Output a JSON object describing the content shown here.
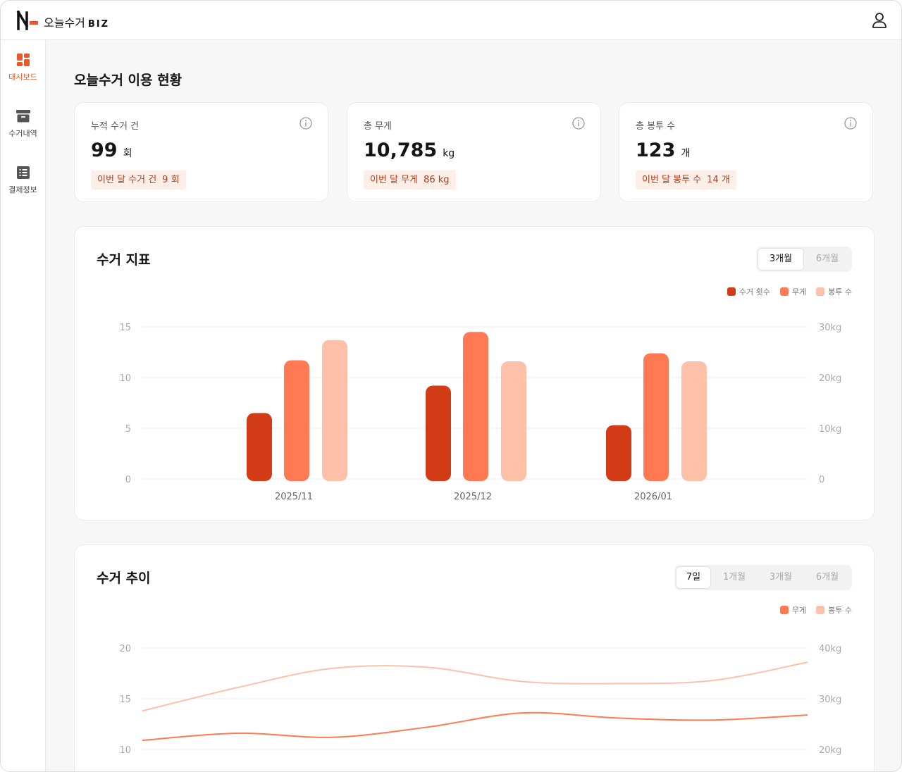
{
  "app": {
    "brand_name": "오늘수거",
    "brand_suffix": "BIZ"
  },
  "sidebar": {
    "items": [
      {
        "label": "대시보드",
        "icon": "dashboard-icon",
        "active": true
      },
      {
        "label": "수거내역",
        "icon": "archive-icon",
        "active": false
      },
      {
        "label": "결제정보",
        "icon": "list-icon",
        "active": false
      }
    ]
  },
  "page": {
    "title": "오늘수거 이용 현황"
  },
  "stats": [
    {
      "label": "누적 수거 건",
      "value": "99",
      "unit": "회",
      "badge_label": "이번 달 수거 건",
      "badge_value": "9 회"
    },
    {
      "label": "총 무게",
      "value": "10,785",
      "unit": "kg",
      "badge_label": "이번 달 무게",
      "badge_value": "86 kg"
    },
    {
      "label": "총 봉투 수",
      "value": "123",
      "unit": "개",
      "badge_label": "이번 달 봉투 수",
      "badge_value": "14 개"
    }
  ],
  "colors": {
    "count": "#d13b16",
    "weight": "#ff7a52",
    "bags": "#ffc0aa",
    "accent": "#e85a2c"
  },
  "indicator_panel": {
    "title": "수거 지표",
    "tabs": [
      {
        "label": "3개월",
        "active": true
      },
      {
        "label": "6개월",
        "active": false
      }
    ],
    "legend": [
      "수거 횟수",
      "무게",
      "봉투 수"
    ]
  },
  "trend_panel": {
    "title": "수거 추이",
    "tabs": [
      {
        "label": "7일",
        "active": true
      },
      {
        "label": "1개월",
        "active": false
      },
      {
        "label": "3개월",
        "active": false
      },
      {
        "label": "6개월",
        "active": false
      }
    ],
    "legend": [
      "무게",
      "봉투 수"
    ]
  },
  "chart_data": [
    {
      "type": "bar",
      "categories": [
        "2025/11",
        "2025/12",
        "2026/01"
      ],
      "series": [
        {
          "name": "수거 횟수",
          "axis": "left",
          "values": [
            6.5,
            9.2,
            5.3
          ]
        },
        {
          "name": "무게",
          "axis": "left",
          "values": [
            11.7,
            14.5,
            12.4
          ]
        },
        {
          "name": "봉투 수",
          "axis": "left",
          "values": [
            13.7,
            11.6,
            11.6
          ]
        }
      ],
      "y_left": {
        "ticks": [
          "0",
          "5",
          "10",
          "15"
        ],
        "ylim": [
          0,
          15
        ]
      },
      "y_right": {
        "ticks": [
          "0",
          "10kg",
          "20kg",
          "30kg"
        ],
        "ylim": [
          0,
          30
        ]
      },
      "grid": true,
      "legend_position": "top-right"
    },
    {
      "type": "line",
      "series": [
        {
          "name": "무게",
          "values": [
            10.9,
            11.6,
            11.2,
            12.2,
            13.6,
            13.1,
            12.9,
            13.4
          ]
        },
        {
          "name": "봉투 수",
          "values": [
            13.8,
            16.1,
            18.0,
            18.1,
            16.7,
            16.5,
            16.8,
            18.6
          ]
        }
      ],
      "y_left": {
        "ticks": [
          "10",
          "15",
          "20"
        ]
      },
      "y_right": {
        "ticks": [
          "20kg",
          "30kg",
          "40kg"
        ]
      },
      "grid": true,
      "legend_position": "top-right"
    }
  ]
}
